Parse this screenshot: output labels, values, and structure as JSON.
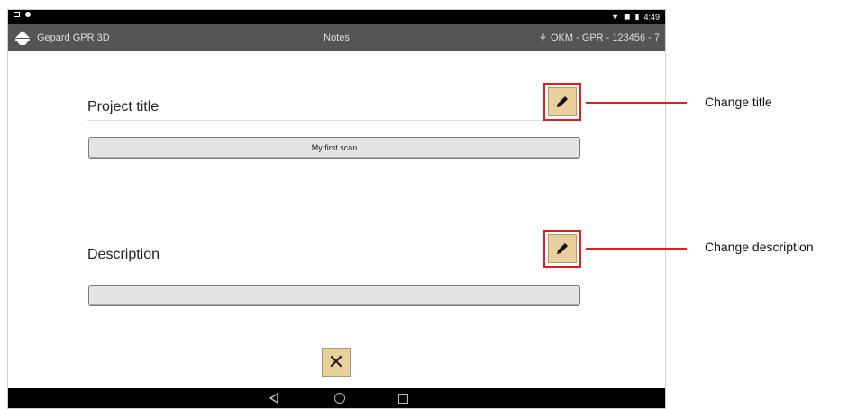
{
  "app_bar": {
    "app_name": "Gepard GPR 3D",
    "screen_title": "Notes",
    "device_id": "OKM - GPR - 123456 - 7"
  },
  "status_bar": {
    "time": "4:49"
  },
  "project_title": {
    "label": "Project title",
    "value": "My first scan"
  },
  "description": {
    "label": "Description",
    "value": ""
  },
  "callouts": {
    "change_title": "Change title",
    "change_description": "Change description"
  },
  "colors": {
    "highlight": "#e41c1c",
    "button_fill": "#e8cf9c",
    "app_bar": "#555555"
  }
}
